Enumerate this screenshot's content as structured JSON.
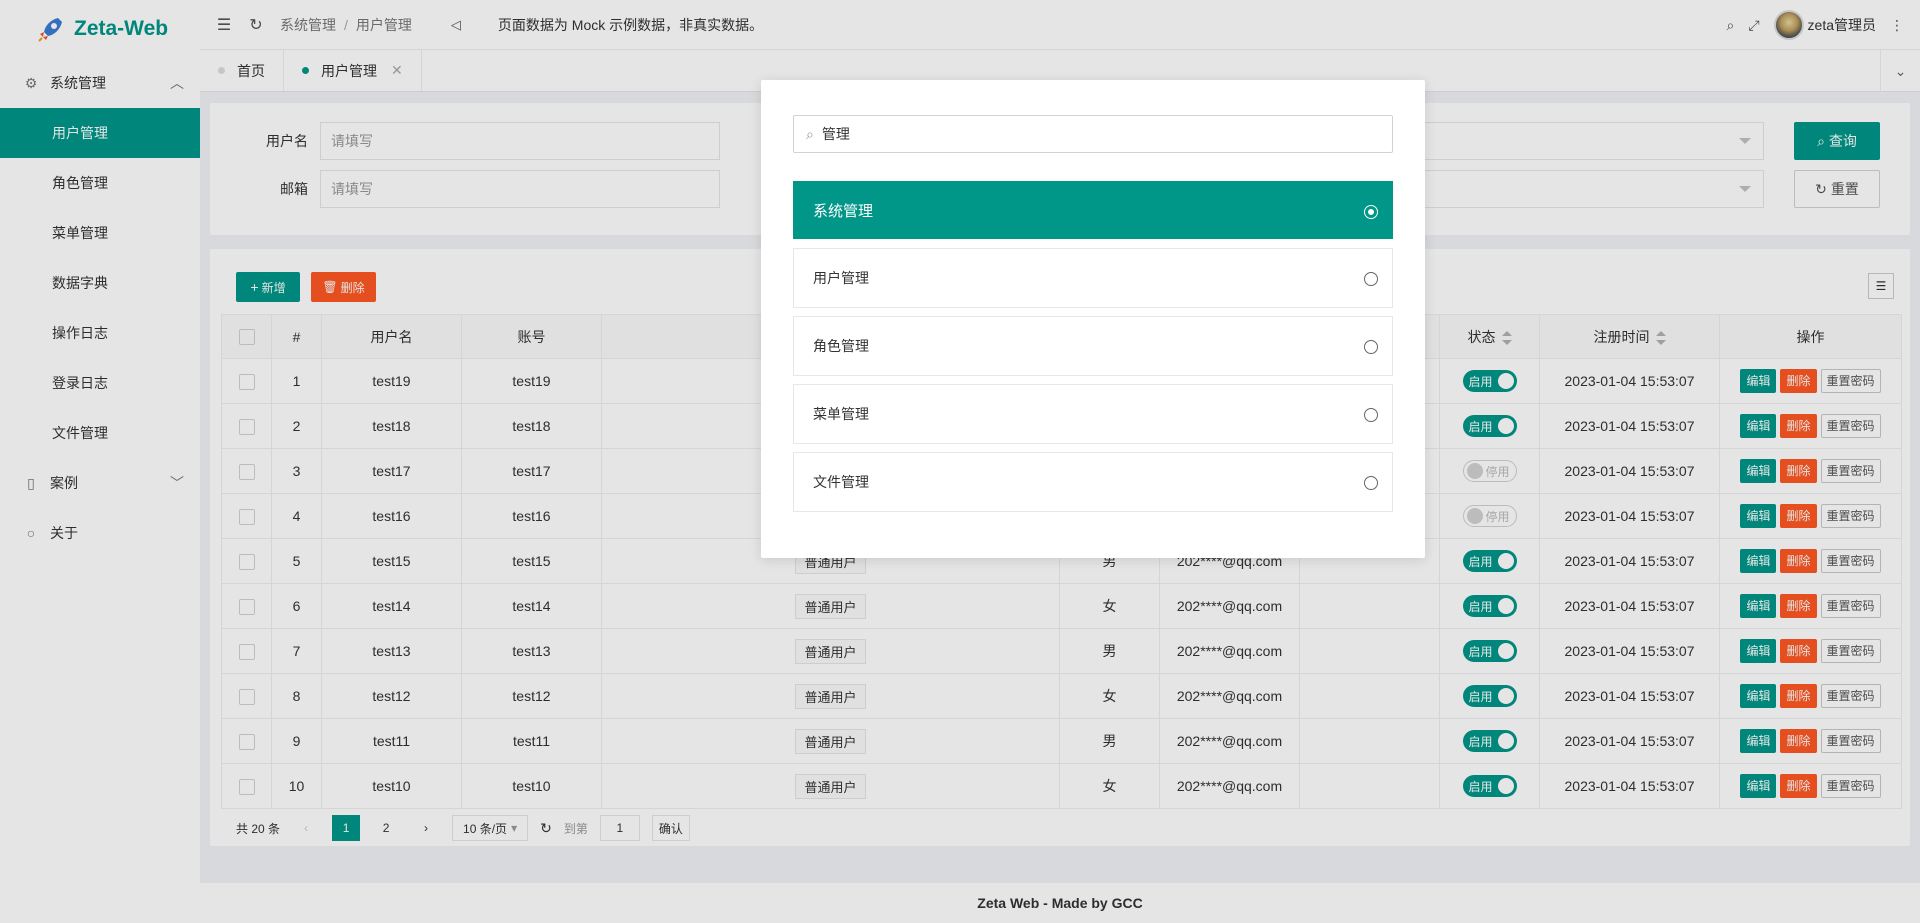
{
  "app": {
    "name": "Zeta-Web"
  },
  "sidebar": {
    "groups": [
      {
        "label": "系统管理",
        "icon": "gear-icon",
        "expanded": true
      },
      {
        "label": "案例",
        "icon": "case-icon",
        "expanded": false
      },
      {
        "label": "关于",
        "icon": "circle-icon",
        "expanded": false
      }
    ],
    "sub_items": [
      "用户管理",
      "角色管理",
      "菜单管理",
      "数据字典",
      "操作日志",
      "登录日志",
      "文件管理"
    ]
  },
  "topbar": {
    "breadcrumb": [
      "系统管理",
      "用户管理"
    ],
    "notice": "页面数据为 Mock 示例数据，非真实数据。",
    "user": "zeta管理员"
  },
  "tabs": [
    {
      "label": "首页",
      "active": false
    },
    {
      "label": "用户管理",
      "active": true
    }
  ],
  "search_form": {
    "username_label": "用户名",
    "username_placeholder": "请填写",
    "email_label": "邮箱",
    "email_placeholder": "请填写",
    "query_button": "查询",
    "reset_button": "重置"
  },
  "toolbar": {
    "add_button": "新增",
    "delete_button": "删除"
  },
  "table": {
    "headers": [
      "#",
      "用户名",
      "账号",
      "",
      "",
      "",
      "",
      "状态",
      "注册时间",
      "操作"
    ],
    "action_labels": {
      "edit": "编辑",
      "delete": "删除",
      "reset": "重置密码"
    },
    "status_labels": {
      "on": "启用",
      "off": "停用"
    },
    "rows": [
      {
        "idx": "1",
        "username": "test19",
        "account": "test19",
        "role": "",
        "gender": "",
        "email": "",
        "status": "on",
        "time": "2023-01-04 15:53:07"
      },
      {
        "idx": "2",
        "username": "test18",
        "account": "test18",
        "role": "",
        "gender": "",
        "email": "",
        "status": "on",
        "time": "2023-01-04 15:53:07"
      },
      {
        "idx": "3",
        "username": "test17",
        "account": "test17",
        "role": "",
        "gender": "",
        "email": "",
        "status": "off",
        "time": "2023-01-04 15:53:07"
      },
      {
        "idx": "4",
        "username": "test16",
        "account": "test16",
        "role": "",
        "gender": "",
        "email": "",
        "status": "off",
        "time": "2023-01-04 15:53:07"
      },
      {
        "idx": "5",
        "username": "test15",
        "account": "test15",
        "role": "普通用户",
        "gender": "男",
        "email": "202****@qq.com",
        "status": "on",
        "time": "2023-01-04 15:53:07"
      },
      {
        "idx": "6",
        "username": "test14",
        "account": "test14",
        "role": "普通用户",
        "gender": "女",
        "email": "202****@qq.com",
        "status": "on",
        "time": "2023-01-04 15:53:07"
      },
      {
        "idx": "7",
        "username": "test13",
        "account": "test13",
        "role": "普通用户",
        "gender": "男",
        "email": "202****@qq.com",
        "status": "on",
        "time": "2023-01-04 15:53:07"
      },
      {
        "idx": "8",
        "username": "test12",
        "account": "test12",
        "role": "普通用户",
        "gender": "女",
        "email": "202****@qq.com",
        "status": "on",
        "time": "2023-01-04 15:53:07"
      },
      {
        "idx": "9",
        "username": "test11",
        "account": "test11",
        "role": "普通用户",
        "gender": "男",
        "email": "202****@qq.com",
        "status": "on",
        "time": "2023-01-04 15:53:07"
      },
      {
        "idx": "10",
        "username": "test10",
        "account": "test10",
        "role": "普通用户",
        "gender": "女",
        "email": "202****@qq.com",
        "status": "on",
        "time": "2023-01-04 15:53:07"
      }
    ]
  },
  "pagination": {
    "total": "共 20 条",
    "pages": [
      "1",
      "2"
    ],
    "current": "1",
    "page_size": "10 条/页",
    "goto_label": "到第",
    "goto_value": "1",
    "confirm": "确认"
  },
  "footer": "Zeta Web - Made by GCC",
  "modal": {
    "search_value": "管理",
    "options": [
      {
        "label": "系统管理",
        "selected": true
      },
      {
        "label": "用户管理",
        "selected": false
      },
      {
        "label": "角色管理",
        "selected": false
      },
      {
        "label": "菜单管理",
        "selected": false
      },
      {
        "label": "文件管理",
        "selected": false
      }
    ]
  },
  "colors": {
    "primary": "#009688",
    "danger": "#ff5722"
  }
}
